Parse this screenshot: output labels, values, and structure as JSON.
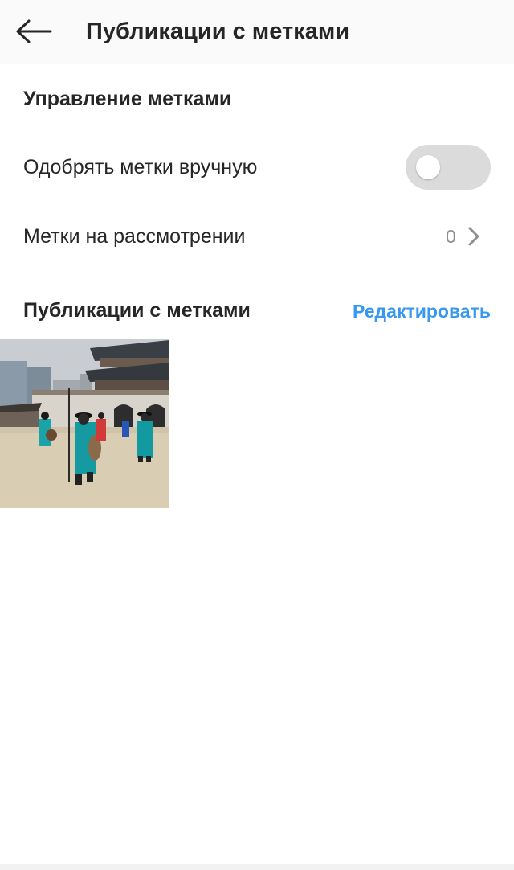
{
  "header": {
    "title": "Публикации с метками"
  },
  "controls": {
    "section_title": "Управление метками",
    "manual_approve": {
      "label": "Одобрять метки вручную",
      "enabled": false
    },
    "pending": {
      "label": "Метки на рассмотрении",
      "count": "0"
    }
  },
  "tagged": {
    "section_title": "Публикации с метками",
    "edit_label": "Редактировать",
    "posts": [
      {
        "thumbnail": "palace-guards-photo"
      }
    ]
  },
  "colors": {
    "link": "#3897f0",
    "toggle_off": "#dbdbdb",
    "text": "#262626",
    "muted": "#8e8e8e"
  }
}
